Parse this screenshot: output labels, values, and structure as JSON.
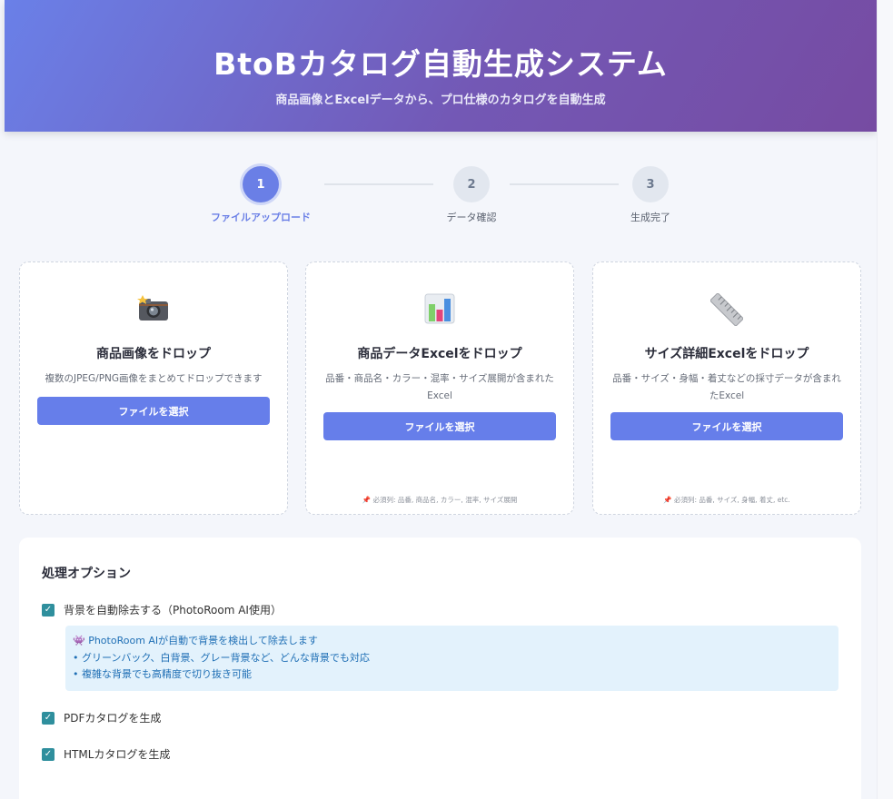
{
  "header": {
    "title": "BtoBカタログ自動生成システム",
    "subtitle": "商品画像とExcelデータから、プロ仕様のカタログを自動生成"
  },
  "steps": [
    {
      "number": "1",
      "label": "ファイルアップロード",
      "active": true
    },
    {
      "number": "2",
      "label": "データ確認",
      "active": false
    },
    {
      "number": "3",
      "label": "生成完了",
      "active": false
    }
  ],
  "cards": [
    {
      "icon": "camera-icon",
      "title": "商品画像をドロップ",
      "desc": "複数のJPEG/PNG画像をまとめてドロップできます",
      "button": "ファイルを選択",
      "required": ""
    },
    {
      "icon": "bar-chart-icon",
      "title": "商品データExcelをドロップ",
      "desc": "品番・商品名・カラー・混率・サイズ展開が含まれたExcel",
      "button": "ファイルを選択",
      "required": "必須列: 品番, 商品名, カラー, 混率, サイズ展開"
    },
    {
      "icon": "ruler-icon",
      "title": "サイズ詳細Excelをドロップ",
      "desc": "品番・サイズ・身幅・着丈などの採寸データが含まれたExcel",
      "button": "ファイルを選択",
      "required": "必須列: 品番, サイズ, 身幅, 着丈, etc."
    }
  ],
  "options": {
    "title": "処理オプション",
    "remove_bg": {
      "label": "背景を自動除去する（PhotoRoom AI使用）",
      "checked": true
    },
    "info": [
      "PhotoRoom AIが自動で背景を検出して除去します",
      "• グリーンバック、白背景、グレー背景など、どんな背景でも対応",
      "• 複雑な背景でも高精度で切り抜き可能"
    ],
    "pdf": {
      "label": "PDFカタログを生成",
      "checked": true
    },
    "html": {
      "label": "HTMLカタログを生成",
      "checked": true
    }
  },
  "colors": {
    "accent": "#667eea",
    "header_start": "#667eea",
    "header_end": "#764ba2",
    "checkbox": "#2f8f9d",
    "info_bg": "#e3f2fc",
    "info_text": "#1f6fb5"
  }
}
